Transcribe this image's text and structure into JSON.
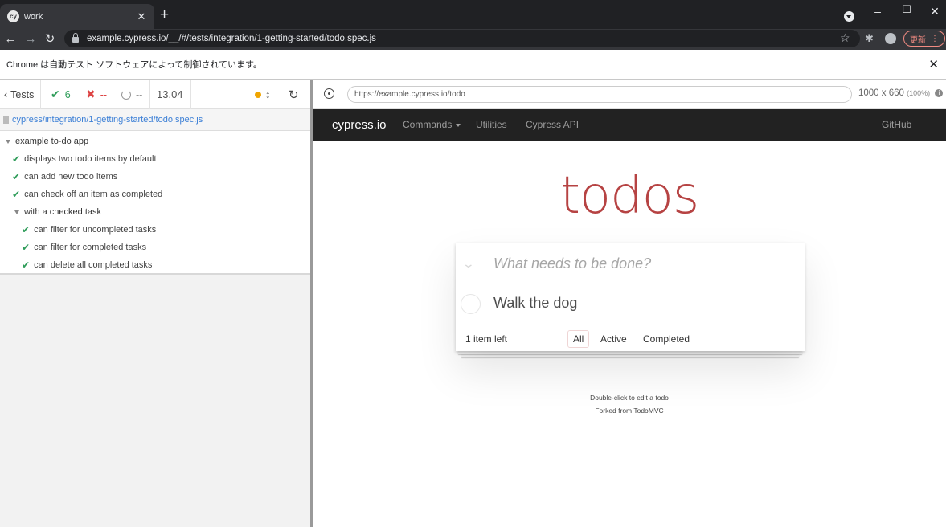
{
  "browser": {
    "tab_title": "work",
    "favicon_text": "cy",
    "new_tab": "+",
    "url": "example.cypress.io/__/#/tests/integration/1-getting-started/todo.spec.js",
    "update_label": "更新",
    "infobar_text": "Chrome は自動テスト ソフトウェアによって制御されています。"
  },
  "runner": {
    "tests_label": "Tests",
    "passed": "6",
    "failed": "--",
    "pending": "--",
    "duration": "13.04",
    "spec_path": "cypress/integration/1-getting-started/todo.spec.js",
    "suite": "example to-do app",
    "tests": [
      "displays two todo items by default",
      "can add new todo items",
      "can check off an item as completed"
    ],
    "nested_suite": "with a checked task",
    "nested_tests": [
      "can filter for uncompleted tasks",
      "can filter for completed tasks",
      "can delete all completed tasks"
    ],
    "aut_url": "https://example.cypress.io/todo",
    "viewport": "1000 x 660",
    "viewport_scale": "(100%)"
  },
  "app": {
    "brand": "cypress.io",
    "nav": [
      "Commands",
      "Utilities",
      "Cypress API"
    ],
    "github": "GitHub",
    "title": "todos",
    "new_todo_placeholder": "What needs to be done?",
    "todo_items": [
      "Walk the dog"
    ],
    "item_count": "1 item left",
    "filters": [
      "All",
      "Active",
      "Completed"
    ],
    "selected_filter": "All",
    "footer_line1": "Double-click to edit a todo",
    "footer_line2": "Forked from TodoMVC"
  },
  "colors": {
    "pass": "#2e9c59",
    "fail": "#dd4444",
    "todos_title": "#af2f2f",
    "app_nav_bg": "#222222"
  }
}
